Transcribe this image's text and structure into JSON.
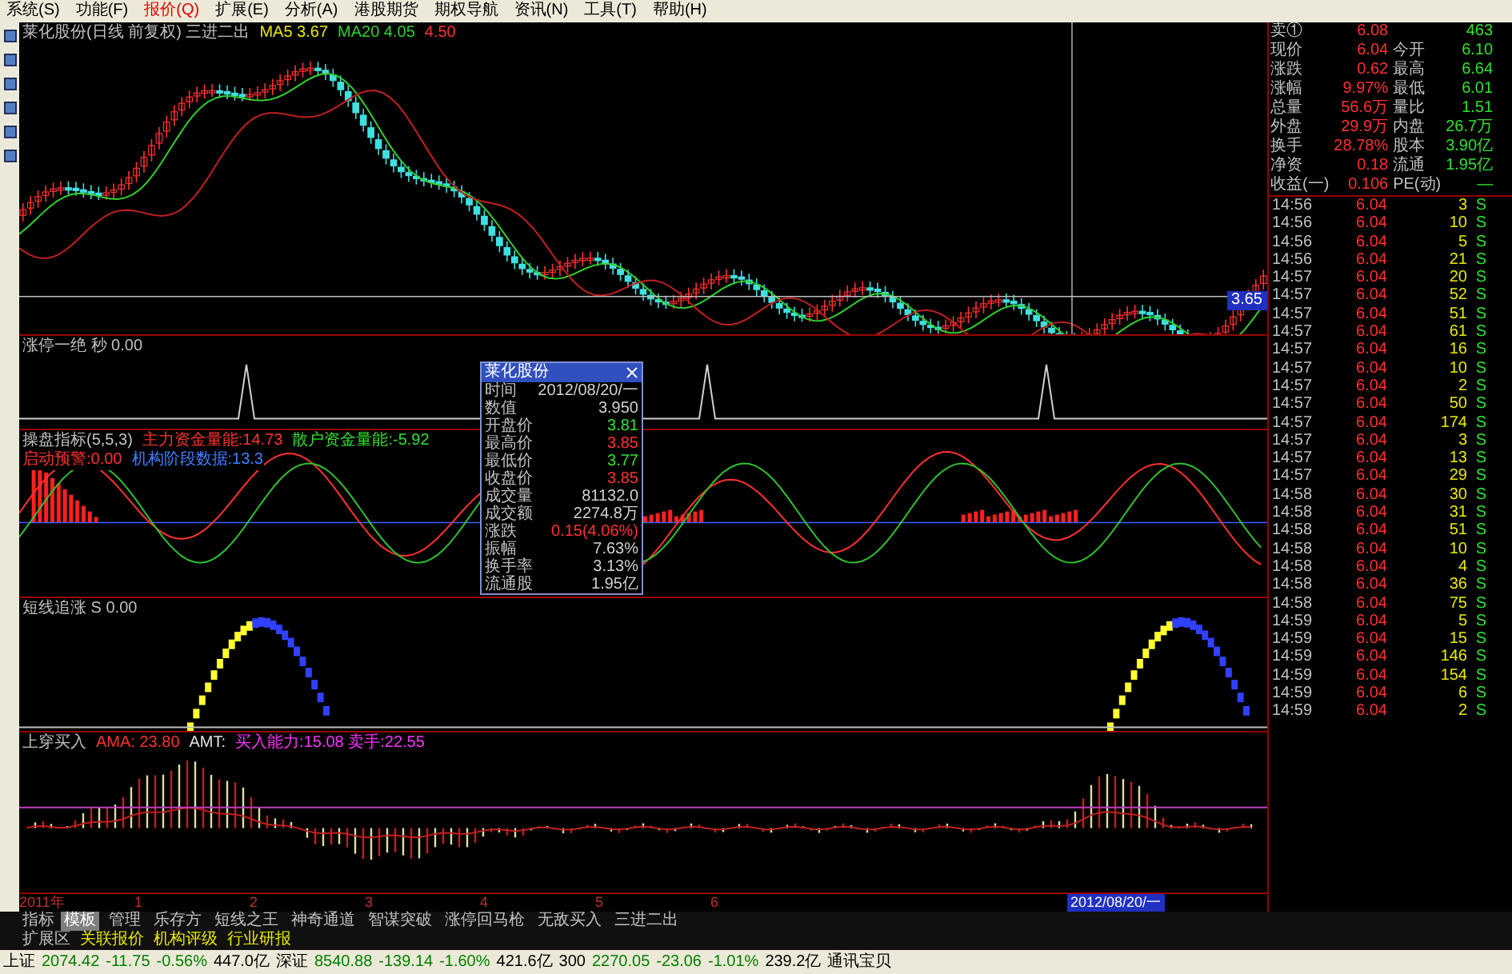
{
  "menu": [
    {
      "label": "系统(S)",
      "selected": false
    },
    {
      "label": "功能(F)",
      "selected": false
    },
    {
      "label": "报价(Q)",
      "selected": true
    },
    {
      "label": "扩展(E)",
      "selected": false
    },
    {
      "label": "分析(A)",
      "selected": false
    },
    {
      "label": "港股期货",
      "selected": false
    },
    {
      "label": "期权导航",
      "selected": false
    },
    {
      "label": "资讯(N)",
      "selected": false
    },
    {
      "label": "工具(T)",
      "selected": false
    },
    {
      "label": "帮助(H)",
      "selected": false
    }
  ],
  "main_chart": {
    "title": "莱化股份(日线 前复权) 三进二出",
    "legends": [
      {
        "text": "MA5 3.67",
        "color": "#e8e800"
      },
      {
        "text": "MA20 4.05",
        "color": "#30d030"
      },
      {
        "text": "4.50",
        "color": "#ff3030"
      }
    ],
    "price_marker": "3.65"
  },
  "indicators": [
    {
      "kind": "spike",
      "title": "涨停一绝 秒 0.00"
    },
    {
      "kind": "oscillator",
      "title": "操盘指标(5,5,3)",
      "legends": [
        {
          "text": "主力资金量能:14.73",
          "color": "#ff3030"
        },
        {
          "text": "散户资金量能:-5.92",
          "color": "#30e030"
        },
        {
          "text": "启动预警:0.00",
          "color": "#ff3030"
        },
        {
          "text": "机构阶段数据:13.3",
          "color": "#4080ff"
        }
      ]
    },
    {
      "kind": "arc",
      "title": "短线追涨 S 0.00"
    },
    {
      "kind": "histogram",
      "title": "上穿买入",
      "legends": [
        {
          "text": "AMA: 23.80",
          "color": "#ff3030"
        },
        {
          "text": "AMT:",
          "color": "#e0e0e0"
        },
        {
          "text": "买入能力:15.08 卖手:22.55",
          "color": "#ff30ff"
        }
      ]
    }
  ],
  "tooltip": {
    "title": "莱化股份",
    "rows": [
      {
        "label": "时间",
        "value": "2012/08/20/一",
        "color": "#d0d0d0"
      },
      {
        "label": "数值",
        "value": "3.950",
        "color": "#d0d0d0"
      },
      {
        "label": "开盘价",
        "value": "3.81",
        "color": "#30e030"
      },
      {
        "label": "最高价",
        "value": "3.85",
        "color": "#ff3030"
      },
      {
        "label": "最低价",
        "value": "3.77",
        "color": "#30e030"
      },
      {
        "label": "收盘价",
        "value": "3.85",
        "color": "#ff3030"
      },
      {
        "label": "成交量",
        "value": "81132.0",
        "color": "#d0d0d0"
      },
      {
        "label": "成交额",
        "value": "2274.8万",
        "color": "#d0d0d0"
      },
      {
        "label": "涨跌",
        "value": "0.15(4.06%)",
        "color": "#ff3030"
      },
      {
        "label": "振幅",
        "value": "7.63%",
        "color": "#d0d0d0"
      },
      {
        "label": "换手率",
        "value": "3.13%",
        "color": "#d0d0d0"
      },
      {
        "label": "流通股",
        "value": "1.95亿",
        "color": "#d0d0d0"
      }
    ]
  },
  "time_axis": {
    "labels": [
      "2011年",
      "1",
      "2",
      "3",
      "4",
      "5",
      "6"
    ],
    "cursor_date": "2012/08/20/一"
  },
  "bottom_tabs": {
    "label": "指标",
    "tabs": [
      {
        "label": "模板",
        "selected": true
      },
      {
        "label": "管理",
        "selected": false
      },
      {
        "label": "乐存方",
        "selected": false
      },
      {
        "label": "短线之王",
        "selected": false
      },
      {
        "label": "神奇通道",
        "selected": false
      },
      {
        "label": "智谋突破",
        "selected": false
      },
      {
        "label": "涨停回马枪",
        "selected": false
      },
      {
        "label": "无敌买入",
        "selected": false
      },
      {
        "label": "三进二出",
        "selected": false
      }
    ]
  },
  "extension_bar": {
    "label": "扩展区",
    "items": [
      "关联报价",
      "机构评级",
      "行业研报"
    ]
  },
  "quote": [
    {
      "label": "卖①",
      "value": "6.08",
      "value2": "463"
    },
    {
      "label": "现价",
      "value": "6.04",
      "label2": "今开",
      "value2": "6.10"
    },
    {
      "label": "涨跌",
      "value": "0.62",
      "label2": "最高",
      "value2": "6.64"
    },
    {
      "label": "涨幅",
      "value": "9.97%",
      "label2": "最低",
      "value2": "6.01"
    },
    {
      "label": "总量",
      "value": "56.6万",
      "label2": "量比",
      "value2": "1.51"
    },
    {
      "label": "外盘",
      "value": "29.9万",
      "label2": "内盘",
      "value2": "26.7万"
    },
    {
      "label": "换手",
      "value": "28.78%",
      "label2": "股本",
      "value2": "3.90亿"
    },
    {
      "label": "净资",
      "value": "0.18",
      "label2": "流通",
      "value2": "1.95亿"
    },
    {
      "label": "收益(一)",
      "value": "0.106",
      "label2": "PE(动)",
      "value2": "—"
    }
  ],
  "ticks": [
    {
      "time": "14:56",
      "price": "6.04",
      "volume": "3",
      "side": "S"
    },
    {
      "time": "14:56",
      "price": "6.04",
      "volume": "10",
      "side": "S"
    },
    {
      "time": "14:56",
      "price": "6.04",
      "volume": "5",
      "side": "S"
    },
    {
      "time": "14:56",
      "price": "6.04",
      "volume": "21",
      "side": "S"
    },
    {
      "time": "14:57",
      "price": "6.04",
      "volume": "20",
      "side": "S"
    },
    {
      "time": "14:57",
      "price": "6.04",
      "volume": "52",
      "side": "S"
    },
    {
      "time": "14:57",
      "price": "6.04",
      "volume": "51",
      "side": "S"
    },
    {
      "time": "14:57",
      "price": "6.04",
      "volume": "61",
      "side": "S"
    },
    {
      "time": "14:57",
      "price": "6.04",
      "volume": "16",
      "side": "S"
    },
    {
      "time": "14:57",
      "price": "6.04",
      "volume": "10",
      "side": "S"
    },
    {
      "time": "14:57",
      "price": "6.04",
      "volume": "2",
      "side": "S"
    },
    {
      "time": "14:57",
      "price": "6.04",
      "volume": "50",
      "side": "S"
    },
    {
      "time": "14:57",
      "price": "6.04",
      "volume": "174",
      "side": "S"
    },
    {
      "time": "14:57",
      "price": "6.04",
      "volume": "3",
      "side": "S"
    },
    {
      "time": "14:57",
      "price": "6.04",
      "volume": "13",
      "side": "S"
    },
    {
      "time": "14:57",
      "price": "6.04",
      "volume": "29",
      "side": "S"
    },
    {
      "time": "14:58",
      "price": "6.04",
      "volume": "30",
      "side": "S"
    },
    {
      "time": "14:58",
      "price": "6.04",
      "volume": "31",
      "side": "S"
    },
    {
      "time": "14:58",
      "price": "6.04",
      "volume": "51",
      "side": "S"
    },
    {
      "time": "14:58",
      "price": "6.04",
      "volume": "10",
      "side": "S"
    },
    {
      "time": "14:58",
      "price": "6.04",
      "volume": "4",
      "side": "S"
    },
    {
      "time": "14:58",
      "price": "6.04",
      "volume": "36",
      "side": "S"
    },
    {
      "time": "14:58",
      "price": "6.04",
      "volume": "75",
      "side": "S"
    },
    {
      "time": "14:59",
      "price": "6.04",
      "volume": "5",
      "side": "S"
    },
    {
      "time": "14:59",
      "price": "6.04",
      "volume": "15",
      "side": "S"
    },
    {
      "time": "14:59",
      "price": "6.04",
      "volume": "146",
      "side": "S"
    },
    {
      "time": "14:59",
      "price": "6.04",
      "volume": "154",
      "side": "S"
    },
    {
      "time": "14:59",
      "price": "6.04",
      "volume": "6",
      "side": "S"
    },
    {
      "time": "14:59",
      "price": "6.04",
      "volume": "2",
      "side": "S"
    }
  ],
  "status_bar": [
    {
      "text": "上证",
      "color": "#000000"
    },
    {
      "text": "2074.42",
      "color": "#008000"
    },
    {
      "text": "-11.75",
      "color": "#008000"
    },
    {
      "text": "-0.56%",
      "color": "#008000"
    },
    {
      "text": "447.0亿",
      "color": "#000000"
    },
    {
      "text": "深证",
      "color": "#000000"
    },
    {
      "text": "8540.88",
      "color": "#008000"
    },
    {
      "text": "-139.14",
      "color": "#008000"
    },
    {
      "text": "-1.60%",
      "color": "#008000"
    },
    {
      "text": "421.6亿",
      "color": "#000000"
    },
    {
      "text": "300",
      "color": "#000000"
    },
    {
      "text": "2270.05",
      "color": "#008000"
    },
    {
      "text": "-23.06",
      "color": "#008000"
    },
    {
      "text": "-1.01%",
      "color": "#008000"
    },
    {
      "text": "239.2亿",
      "color": "#000000"
    },
    {
      "text": "通讯宝贝",
      "color": "#000000"
    }
  ]
}
